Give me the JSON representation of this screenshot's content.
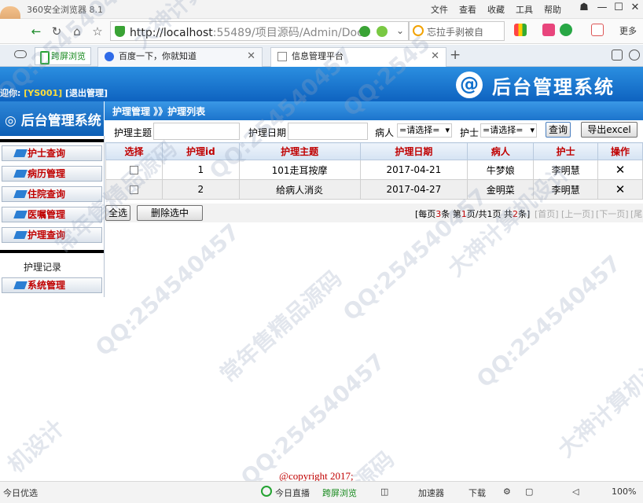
{
  "browser": {
    "app_name": "360安全浏览器 8.1",
    "menus": [
      "文件",
      "查看",
      "收藏",
      "工具",
      "帮助"
    ],
    "url_host": "http://localhost",
    "url_rest": ":55489/项目源码/Admin/Docto",
    "search_text": "忘拉手剥被自",
    "more_label": "更多",
    "tabs": [
      {
        "label": "跨屏浏览"
      },
      {
        "label": "百度一下，你就知道"
      },
      {
        "label": "信息管理平台"
      }
    ]
  },
  "header": {
    "logo_glyph": "@",
    "title": "后台管理系统",
    "welcome_prefix": "迎你:",
    "user_id": "[YS001]",
    "logout": "[退出管理]"
  },
  "sidebar": {
    "title": "后台管理系统",
    "items": [
      {
        "label": "护士查询"
      },
      {
        "label": "病历管理"
      },
      {
        "label": "住院查询"
      },
      {
        "label": "医嘱管理"
      },
      {
        "label": "护理查询"
      }
    ],
    "sub_item": "护理记录",
    "system": "系统管理"
  },
  "breadcrumb": "护理管理 》》护理列表",
  "filters": {
    "subject_label": "护理主题",
    "date_label": "护理日期",
    "patient_label": "病人",
    "patient_value": "=请选择=",
    "nurse_label": "护士",
    "nurse_value": "=请选择=",
    "search_button": "查询",
    "export_button": "导出excel"
  },
  "table": {
    "headers": [
      "选择",
      "护理id",
      "护理主题",
      "护理日期",
      "病人",
      "护士",
      "操作"
    ],
    "rows": [
      {
        "id": "1",
        "subject": "101走耳按摩",
        "date": "2017-04-21",
        "patient": "牛梦娘",
        "nurse": "李明慧"
      },
      {
        "id": "2",
        "subject": "给病人消炎",
        "date": "2017-04-27",
        "patient": "金明菜",
        "nurse": "李明慧"
      }
    ]
  },
  "actions": {
    "select_all": "全选",
    "delete_selected": "删除选中"
  },
  "pager": {
    "prefix": "[每页",
    "per_page": "3",
    "mid1": "条 第",
    "current": "1",
    "mid2": "页/共",
    "pages": "1",
    "mid3": "页 共",
    "total": "2",
    "suffix": "条]",
    "first": "[首页]",
    "prev": "[上一页]",
    "next": "[下一页]",
    "last": "[尾"
  },
  "footer": {
    "copyright": "@copyright 2017;"
  },
  "statusbar": {
    "left": "今日优选",
    "live": "今日直播",
    "cross": "跨屏浏览",
    "accel": "加速器",
    "download": "下载",
    "zoom": "100%"
  },
  "watermarks": [
    "QQ:25454045",
    "大神计算机设计",
    "常年售精品源码",
    "QQ:254540457",
    "QQ:2545",
    "大神计算机设计",
    "QQ:254540457",
    "常年售精品源码",
    "QQ:254540457",
    "大神计算机设计",
    "QQ:254540457",
    "机设计",
    "QQ:254540457",
    "品源码"
  ],
  "colors": {
    "header_blue": "#0e63c0",
    "accent_red": "#c00000"
  }
}
